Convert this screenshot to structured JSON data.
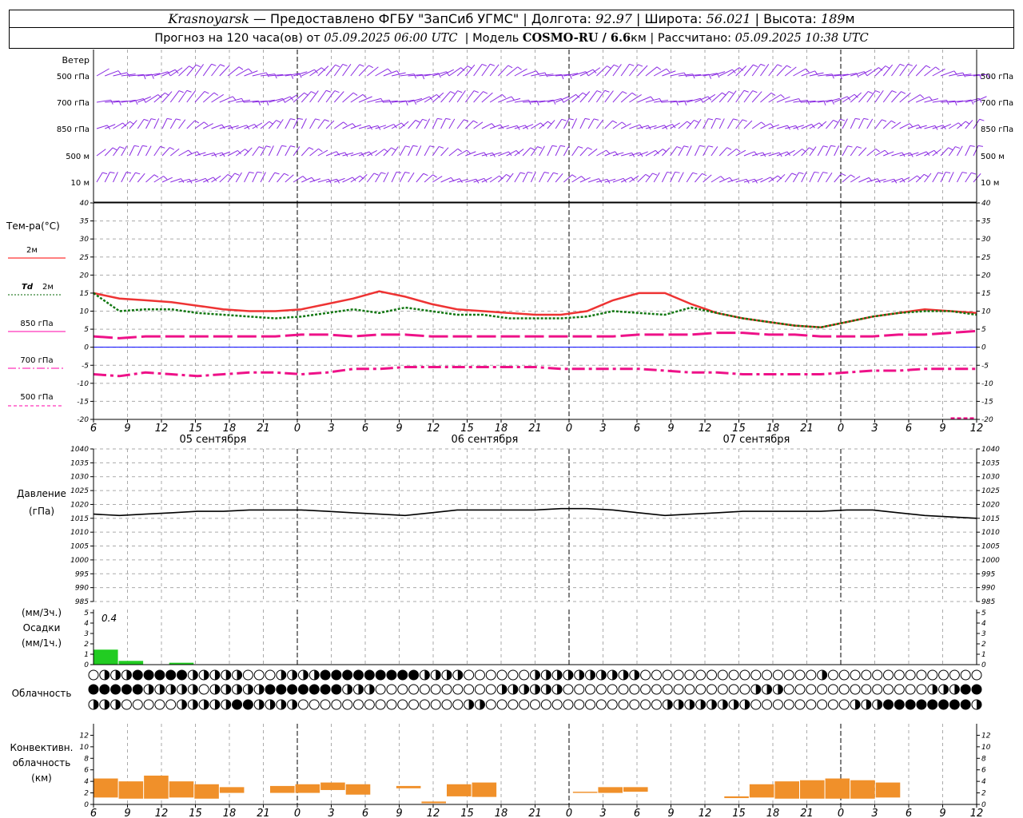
{
  "header": {
    "city": "Krasnoyarsk",
    "dash": "—",
    "provider": "Предоставлено ФГБУ \"ЗапСиб УГМС\"",
    "lon_label": "Долгота:",
    "lon_value": "92.97",
    "lat_label": "Широта:",
    "lat_value": "56.021",
    "alt_label": "Высота:",
    "alt_value": "189",
    "alt_unit": "м",
    "forecast_prefix": "Прогноз на 120 часа(ов) от",
    "forecast_date": "05.09.2025 06:00 UTC",
    "model_label": "Модель",
    "model_name": "COSMO-RU / 6.6",
    "model_unit": "км",
    "calc_label": "Рассчитано:",
    "calc_date": "05.09.2025 10:38 UTC"
  },
  "time_axis": {
    "tick_labels": [
      "6",
      "9",
      "12",
      "15",
      "18",
      "21",
      "0",
      "3",
      "6",
      "9",
      "12",
      "15",
      "18",
      "21",
      "0",
      "3",
      "6",
      "9",
      "12",
      "15",
      "18",
      "21",
      "0",
      "3",
      "6",
      "9",
      "12"
    ],
    "day_labels": [
      "05 сентября",
      "06 сентября",
      "07 сентября"
    ]
  },
  "wind_panel": {
    "title": "Ветер",
    "levels": [
      "500 гПа",
      "700 гПа",
      "850 гПа",
      "500 м",
      "10 м"
    ],
    "color": "#8a2be2"
  },
  "temperature_panel": {
    "title": "Тем-ра(°C)",
    "legend": [
      {
        "label": "2м",
        "color": "#ff0000",
        "dash": "solid"
      },
      {
        "label": "Td",
        "label2": "2м",
        "color": "#006400",
        "dash": "dotted"
      },
      {
        "label": "850 гПа",
        "color": "#ff00aa",
        "dash": "long"
      },
      {
        "label": "700 гПа",
        "color": "#ff00aa",
        "dash": "dashdot"
      },
      {
        "label": "500 гПа",
        "color": "#ff00aa",
        "dash": "short"
      }
    ],
    "ticks": [
      "40",
      "35",
      "30",
      "25",
      "20",
      "15",
      "10",
      "5",
      "0",
      "-5",
      "-10",
      "-15",
      "-20"
    ]
  },
  "pressure_panel": {
    "title": "Давление",
    "unit": "(гПа)",
    "ticks": [
      "1040",
      "1035",
      "1030",
      "1025",
      "1020",
      "1015",
      "1010",
      "1005",
      "1000",
      "995",
      "990",
      "985"
    ]
  },
  "precip_panel": {
    "title1": "(мм/3ч.)",
    "title2": "Осадки",
    "title3": "(мм/1ч.)",
    "ticks": [
      "5",
      "4",
      "3",
      "2",
      "1",
      "0"
    ],
    "max_label": "0.4",
    "color": "#22cc22"
  },
  "cloud_panel": {
    "title": "Облачность"
  },
  "conv_panel": {
    "title1": "Конвективн.",
    "title2": "облачность",
    "title3": "(км)",
    "ticks": [
      "12",
      "10",
      "8",
      "6",
      "4",
      "2",
      "0"
    ],
    "color": "#f0902a"
  },
  "chart_data": [
    {
      "type": "line",
      "title": "Тем-ра(°C)",
      "x_hours_from_start": [
        0,
        3,
        6,
        9,
        12,
        15,
        18,
        21,
        24,
        27,
        30,
        33,
        36,
        39,
        42,
        45,
        48,
        51,
        54,
        57,
        60,
        63,
        66,
        69,
        72,
        75,
        78
      ],
      "ylim": [
        -20,
        40
      ],
      "series": [
        {
          "name": "2м",
          "values": [
            15,
            13.5,
            13,
            12.5,
            11.5,
            10.5,
            10,
            10,
            10.5,
            12,
            13.5,
            15.5,
            14,
            12,
            10.5,
            10,
            9.5,
            9,
            9,
            10,
            13,
            15,
            15,
            12,
            9.5,
            8,
            7,
            6,
            5.5,
            7,
            8.5,
            9.5,
            10.5,
            10,
            9.5
          ]
        },
        {
          "name": "Td 2м",
          "values": [
            15,
            10,
            10.5,
            10.5,
            9.5,
            9,
            8.5,
            8,
            8.5,
            9.5,
            10.5,
            9.5,
            11,
            10,
            9,
            9,
            8,
            8,
            8,
            8.5,
            10,
            9.5,
            9,
            11,
            9.5,
            8,
            7,
            6,
            5.5,
            7,
            8.5,
            9.5,
            10,
            10,
            9
          ]
        },
        {
          "name": "850 гПа",
          "values": [
            3,
            2.5,
            3,
            3,
            3,
            3,
            3,
            3,
            3.5,
            3.5,
            3,
            3.5,
            3.5,
            3,
            3,
            3,
            3,
            3,
            3,
            3,
            3,
            3.5,
            3.5,
            3.5,
            4,
            4,
            3.5,
            3.5,
            3,
            3,
            3,
            3.5,
            3.5,
            4,
            4.5
          ]
        },
        {
          "name": "700 гПа",
          "values": [
            -7.5,
            -8,
            -7,
            -7.5,
            -8,
            -7.5,
            -7,
            -7,
            -7.5,
            -7,
            -6,
            -6,
            -5.5,
            -5.5,
            -5.5,
            -5.5,
            -5.5,
            -5.5,
            -6,
            -6,
            -6,
            -6,
            -6.5,
            -7,
            -7,
            -7.5,
            -7.5,
            -7.5,
            -7.5,
            -7,
            -6.5,
            -6.5,
            -6,
            -6,
            -6
          ]
        },
        {
          "name": "500 гПа",
          "values": [
            null,
            null,
            null,
            null,
            null,
            null,
            null,
            null,
            null,
            null,
            null,
            null,
            null,
            null,
            null,
            null,
            null,
            null,
            null,
            null,
            null,
            null,
            null,
            null,
            null,
            null,
            null,
            null,
            null,
            null,
            null,
            null,
            null,
            -19.7,
            -19.7
          ]
        }
      ]
    },
    {
      "type": "line",
      "title": "Давление",
      "ylim": [
        985,
        1040
      ],
      "series": [
        {
          "name": "Давление",
          "values": [
            1016.5,
            1016,
            1016.5,
            1017,
            1017.5,
            1017.5,
            1018,
            1018,
            1018,
            1017.5,
            1017,
            1016.5,
            1016,
            1017,
            1018,
            1018,
            1018,
            1018,
            1018.5,
            1018.5,
            1018,
            1017,
            1016,
            1016.5,
            1017,
            1017.5,
            1017.5,
            1017.5,
            1017.5,
            1018,
            1018,
            1017,
            1016,
            1015.5,
            1015
          ]
        }
      ]
    },
    {
      "type": "bar",
      "title": "Осадки",
      "ylim": [
        0,
        5
      ],
      "series": [
        {
          "name": "Осадки",
          "values": [
            0.4,
            0.1,
            0,
            0.05,
            0,
            0,
            0,
            0,
            0,
            0,
            0,
            0,
            0,
            0,
            0,
            0,
            0,
            0,
            0,
            0,
            0,
            0,
            0,
            0,
            0,
            0,
            0,
            0,
            0,
            0,
            0,
            0,
            0,
            0,
            0
          ]
        }
      ]
    },
    {
      "type": "bar",
      "title": "Конвективн. облачность (км)",
      "ylim": [
        0,
        14
      ],
      "series": [
        {
          "name": "bottom_km",
          "values": [
            1.2,
            1,
            1,
            1.2,
            1,
            2,
            null,
            2,
            2,
            2.5,
            1.7,
            null,
            2.8,
            0.2,
            1.4,
            1.3,
            null,
            null,
            null,
            2,
            2,
            2.2,
            null,
            null,
            null,
            1.1,
            1.2,
            1,
            1,
            1,
            1,
            1.2,
            null,
            null,
            null
          ]
        },
        {
          "name": "top_km",
          "values": [
            4.5,
            4,
            5,
            4,
            3.5,
            3,
            null,
            3.2,
            3.5,
            3.8,
            3.5,
            null,
            3.2,
            0.5,
            3.5,
            3.8,
            null,
            null,
            null,
            2.2,
            3,
            3,
            null,
            null,
            null,
            1.4,
            3.5,
            4,
            4.2,
            4.5,
            4.2,
            3.8,
            null,
            null,
            null
          ]
        }
      ]
    }
  ]
}
